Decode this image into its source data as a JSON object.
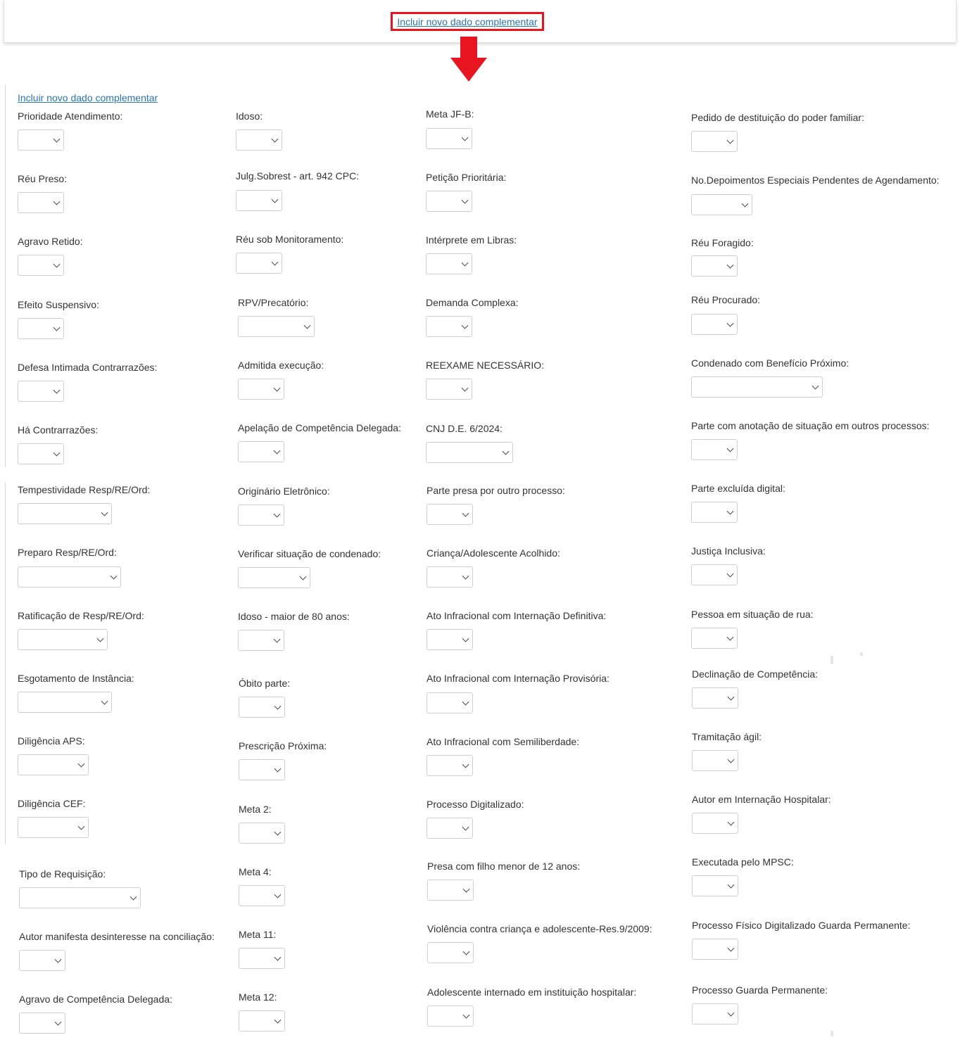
{
  "top_link": "Incluir novo dado complementar",
  "main_link": "Incluir novo dado complementar",
  "colors": {
    "link": "#2b74b8",
    "highlight": "#e8141f",
    "arrow": "#e8141f"
  },
  "icons": {
    "arrow": "red-down-arrow-icon",
    "select": "chevron-down-icon"
  },
  "fields": [
    {
      "label": "Prioridade Atendimento:",
      "value": ""
    },
    {
      "label": "Idoso:",
      "value": ""
    },
    {
      "label": "Meta JF-B:",
      "value": ""
    },
    {
      "label": "Pedido de destituição do poder familiar:",
      "value": ""
    },
    {
      "label": "Réu Preso:",
      "value": ""
    },
    {
      "label": "Julg.Sobrest - art. 942 CPC:",
      "value": ""
    },
    {
      "label": "Petição Prioritária:",
      "value": ""
    },
    {
      "label": "No.Depoimentos Especiais Pendentes de Agendamento:",
      "value": ""
    },
    {
      "label": "Agravo Retido:",
      "value": ""
    },
    {
      "label": "Réu sob Monitoramento:",
      "value": ""
    },
    {
      "label": "Intérprete em Libras:",
      "value": ""
    },
    {
      "label": "Réu Foragido:",
      "value": ""
    },
    {
      "label": "Efeito Suspensivo:",
      "value": ""
    },
    {
      "label": "RPV/Precatório:",
      "value": ""
    },
    {
      "label": "Demanda Complexa:",
      "value": ""
    },
    {
      "label": "Réu Procurado:",
      "value": ""
    },
    {
      "label": "Defesa Intimada Contrarrazões:",
      "value": ""
    },
    {
      "label": "Admitida execução:",
      "value": ""
    },
    {
      "label": "REEXAME NECESSÁRIO:",
      "value": ""
    },
    {
      "label": "Condenado com Benefício Próximo:",
      "value": ""
    },
    {
      "label": "Há Contrarrazões:",
      "value": ""
    },
    {
      "label": "Apelação de Competência Delegada:",
      "value": ""
    },
    {
      "label": "CNJ D.E. 6/2024:",
      "value": ""
    },
    {
      "label": "Parte com anotação de situação em outros processos:",
      "value": ""
    },
    {
      "label": "Tempestividade Resp/RE/Ord:",
      "value": ""
    },
    {
      "label": "Originário Eletrônico:",
      "value": ""
    },
    {
      "label": "Parte presa por outro processo:",
      "value": ""
    },
    {
      "label": "Parte excluída digital:",
      "value": ""
    },
    {
      "label": "Preparo Resp/RE/Ord:",
      "value": ""
    },
    {
      "label": "Verificar situação de condenado:",
      "value": ""
    },
    {
      "label": "Criança/Adolescente Acolhido:",
      "value": ""
    },
    {
      "label": "Justiça Inclusiva:",
      "value": ""
    },
    {
      "label": "Ratificação de Resp/RE/Ord:",
      "value": ""
    },
    {
      "label": "Idoso - maior de 80 anos:",
      "value": ""
    },
    {
      "label": "Ato Infracional com Internação Definitiva:",
      "value": ""
    },
    {
      "label": "Pessoa em situação de rua:",
      "value": ""
    },
    {
      "label": "Esgotamento de Instância:",
      "value": ""
    },
    {
      "label": "Óbito parte:",
      "value": ""
    },
    {
      "label": "Ato Infracional com Internação Provisória:",
      "value": ""
    },
    {
      "label": "Declinação de Competência:",
      "value": ""
    },
    {
      "label": "Diligência APS:",
      "value": ""
    },
    {
      "label": "Prescrição Próxima:",
      "value": ""
    },
    {
      "label": "Ato Infracional com Semiliberdade:",
      "value": ""
    },
    {
      "label": "Tramitação ágil:",
      "value": ""
    },
    {
      "label": "Diligência CEF:",
      "value": ""
    },
    {
      "label": "Meta 2:",
      "value": ""
    },
    {
      "label": "Processo Digitalizado:",
      "value": ""
    },
    {
      "label": "Autor em Internação Hospitalar:",
      "value": ""
    },
    {
      "label": "Tipo de Requisição:",
      "value": ""
    },
    {
      "label": "Meta 4:",
      "value": ""
    },
    {
      "label": "Presa com filho menor de 12 anos:",
      "value": ""
    },
    {
      "label": "Executada pelo MPSC:",
      "value": ""
    },
    {
      "label": "Autor manifesta desinteresse na conciliação:",
      "value": ""
    },
    {
      "label": "Meta 11:",
      "value": ""
    },
    {
      "label": "Violência contra criança e adolescente-Res.9/2009:",
      "value": ""
    },
    {
      "label": "Processo Físico Digitalizado Guarda Permanente:",
      "value": ""
    },
    {
      "label": "Agravo de Competência Delegada:",
      "value": ""
    },
    {
      "label": "Meta 12:",
      "value": ""
    },
    {
      "label": "Adolescente internado em instituição hospitalar:",
      "value": ""
    },
    {
      "label": "Processo Guarda Permanente:",
      "value": ""
    }
  ]
}
